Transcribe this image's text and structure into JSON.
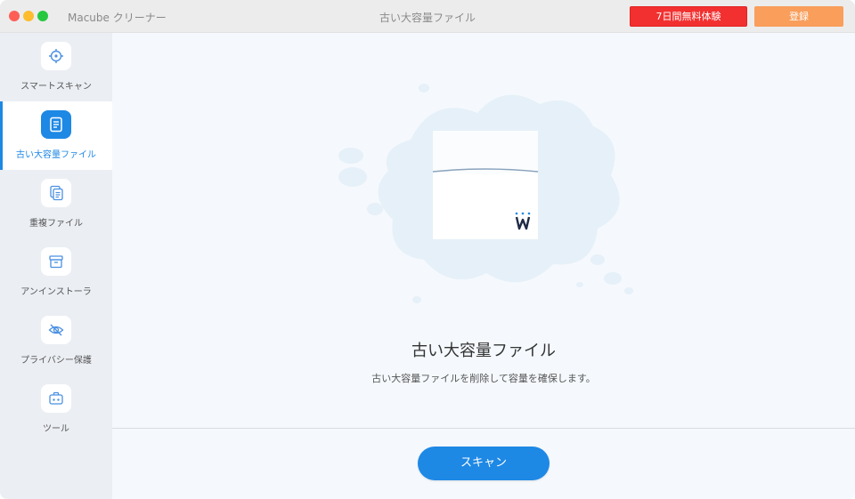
{
  "titlebar": {
    "app_name": "Macube クリーナー",
    "window_title": "古い大容量ファイル",
    "trial_label": "7日間無料体験",
    "register_label": "登録"
  },
  "sidebar": {
    "items": [
      {
        "label": "スマートスキャン",
        "icon": "target-icon",
        "active": false
      },
      {
        "label": "古い大容量ファイル",
        "icon": "document-icon",
        "active": true
      },
      {
        "label": "重複ファイル",
        "icon": "duplicate-files-icon",
        "active": false
      },
      {
        "label": "アンインストーラ",
        "icon": "box-icon",
        "active": false
      },
      {
        "label": "プライバシー保護",
        "icon": "eye-slash-icon",
        "active": false
      },
      {
        "label": "ツール",
        "icon": "toolbox-icon",
        "active": false
      }
    ]
  },
  "main": {
    "title": "古い大容量ファイル",
    "description": "古い大容量ファイルを削除して容量を確保します。",
    "scan_label": "スキャン"
  },
  "colors": {
    "accent": "#1e88e5",
    "trial": "#f23030",
    "register": "#f99e5b",
    "sidebar_bg": "#ebeef3",
    "main_bg": "#f5f9fd"
  }
}
